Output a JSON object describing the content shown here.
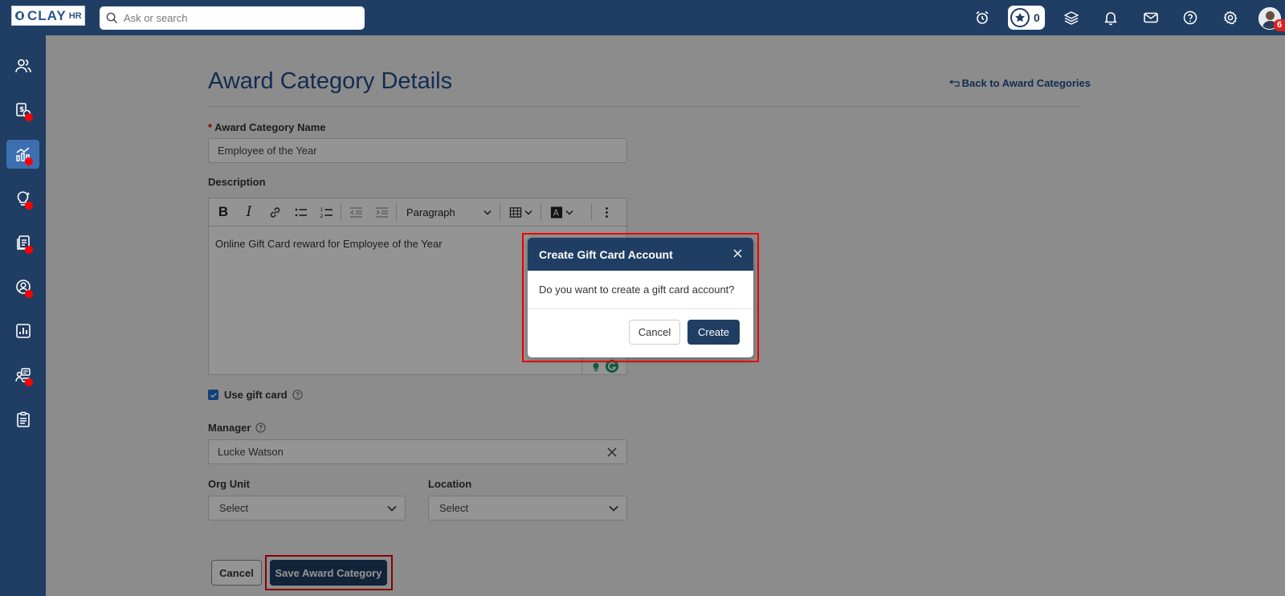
{
  "app": {
    "logo_text": "CLAY",
    "logo_sub": "HR"
  },
  "topbar": {
    "search_placeholder": "Ask or search",
    "star_count": "0",
    "avatar_badge": "6",
    "icons": [
      "alarm-icon",
      "star-icon",
      "layers-icon",
      "bell-icon",
      "mail-icon",
      "help-icon",
      "gear-icon",
      "avatar"
    ]
  },
  "sidebar": {
    "items": [
      {
        "icon": "people-icon",
        "dot": false,
        "active": false
      },
      {
        "icon": "payroll-icon",
        "dot": true,
        "active": false
      },
      {
        "icon": "performance-icon",
        "dot": true,
        "active": true
      },
      {
        "icon": "ideas-icon",
        "dot": true,
        "active": false
      },
      {
        "icon": "documents-icon",
        "dot": true,
        "active": false
      },
      {
        "icon": "profile-icon",
        "dot": true,
        "active": false
      },
      {
        "icon": "reports-icon",
        "dot": false,
        "active": false
      },
      {
        "icon": "recruiting-icon",
        "dot": true,
        "active": false
      },
      {
        "icon": "checklist-icon",
        "dot": false,
        "active": false
      }
    ]
  },
  "page": {
    "title": "Award Category Details",
    "back_link": "Back to Award Categories"
  },
  "form": {
    "name_label": "Award Category Name",
    "name_required": "*",
    "name_value": "Employee of the Year",
    "description_label": "Description",
    "editor": {
      "paragraph_label": "Paragraph",
      "bold_glyph": "B",
      "italic_glyph": "I",
      "content": "Online Gift Card reward for Employee of the Year"
    },
    "use_gift_card_label": "Use gift card",
    "use_gift_card_checked": true,
    "manager_label": "Manager",
    "manager_value": "Lucke Watson",
    "org_unit_label": "Org Unit",
    "org_unit_value": "Select",
    "location_label": "Location",
    "location_value": "Select",
    "cancel_label": "Cancel",
    "save_label": "Save Award Category"
  },
  "modal": {
    "title": "Create Gift Card Account",
    "message": "Do you want to create a gift card account?",
    "cancel_label": "Cancel",
    "create_label": "Create"
  },
  "colors": {
    "primary": "#203e63",
    "accent": "#1f4e8c",
    "active_nav": "#3d6fb0",
    "notification_dot": "#ff0000",
    "highlight": "#ee0000"
  }
}
